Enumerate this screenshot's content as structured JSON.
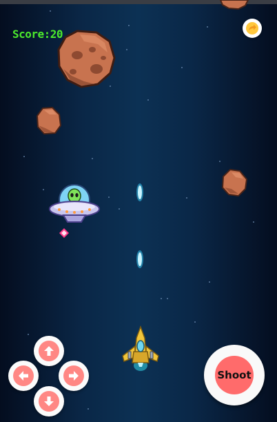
{
  "hud": {
    "score_text": "Score:20",
    "score_color": "#4cea2c"
  },
  "controls": {
    "pause_icon": "refresh-arrow-icon",
    "up_icon": "arrow-up-icon",
    "down_icon": "arrow-down-icon",
    "left_icon": "arrow-left-icon",
    "right_icon": "arrow-right-icon",
    "shoot_label": "Shoot",
    "button_accent": "#ff8784",
    "shoot_accent": "#ff6b6b"
  },
  "sprites": {
    "enemy": "alien-ufo",
    "player": "player-spaceship",
    "obstacles": "asteroids",
    "projectiles": "laser-bolts",
    "enemy_projectile": "pink-energy-shot"
  },
  "colors": {
    "background": "#0c3154",
    "laser": "#39d4ff",
    "asteroid": "#c8734f"
  }
}
